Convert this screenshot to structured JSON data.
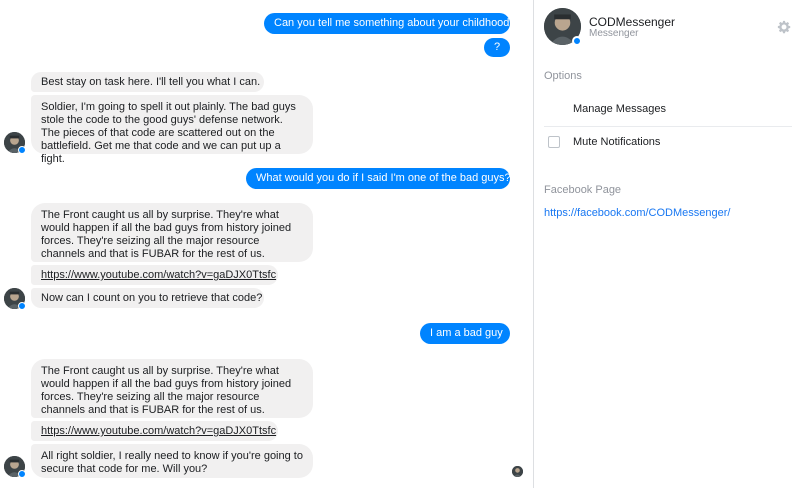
{
  "chat": {
    "messages": {
      "m1": "Can you tell me something about your childhood",
      "m2": "?",
      "m3": "Best stay on task here. I'll tell you what I can.",
      "m4": "Soldier, I'm going to spell it out plainly. The bad guys stole the code to the good guys' defense network. The pieces of that code are scattered out on the battlefield. Get me that code and we can put up a fight.",
      "m5": "What would you do if I said I'm one of the bad guys?",
      "m6": "The Front caught us all by surprise. They're what would happen if all the bad guys from history joined forces. They're seizing all the major resource channels and that is FUBAR for the rest of us.",
      "m7": "https://www.youtube.com/watch?v=gaDJX0Ttsfc",
      "m8": "Now can I count on you to retrieve that code?",
      "m9": "I am a bad guy",
      "m10": "The Front caught us all by surprise. They're what would happen if all the bad guys from history joined forces. They're seizing all the major resource channels and that is FUBAR for the rest of us.",
      "m11": "https://www.youtube.com/watch?v=gaDJX0Ttsfc",
      "m12": "All right soldier, I really need to know if you're going to secure that code for me. Will you?"
    }
  },
  "panel": {
    "name": "CODMessenger",
    "subtitle": "Messenger",
    "options_label": "Options",
    "manage_messages": "Manage Messages",
    "mute_notifications": "Mute Notifications",
    "facebook_page_label": "Facebook Page",
    "facebook_page_url": "https://facebook.com/CODMessenger/"
  },
  "colors": {
    "outgoing_bubble": "#0084ff",
    "incoming_bubble": "#f1f0f0",
    "link": "#1877f2"
  },
  "icons": {
    "settings": "gear-icon",
    "messenger_badge": "messenger-badge-icon"
  }
}
